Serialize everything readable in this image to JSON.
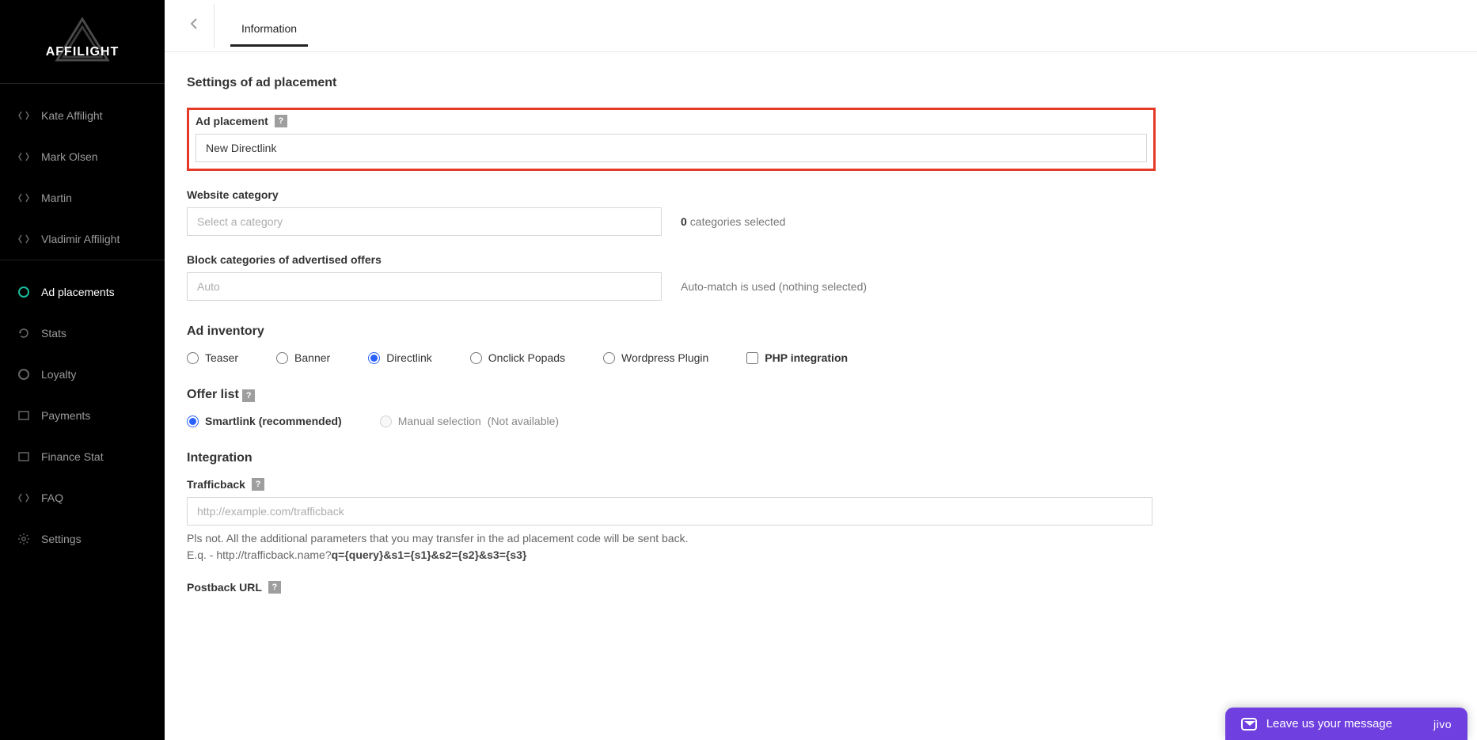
{
  "brand": {
    "name": "AFFILIGHT"
  },
  "sidebar": {
    "users": [
      {
        "label": "Kate Affilight"
      },
      {
        "label": "Mark Olsen"
      },
      {
        "label": "Martin"
      },
      {
        "label": "Vladimir Affilight"
      }
    ],
    "nav": [
      {
        "label": "Ad placements",
        "active": true,
        "icon": "ring"
      },
      {
        "label": "Stats",
        "icon": "refresh"
      },
      {
        "label": "Loyalty",
        "icon": "ring"
      },
      {
        "label": "Payments",
        "icon": "square"
      },
      {
        "label": "Finance Stat",
        "icon": "square"
      },
      {
        "label": "FAQ",
        "icon": "code"
      },
      {
        "label": "Settings",
        "icon": "gear"
      }
    ]
  },
  "tabs": {
    "information": "Information"
  },
  "page": {
    "settings_title": "Settings of ad placement",
    "ad_placement_label": "Ad placement",
    "ad_placement_value": "New Directlink",
    "website_category_label": "Website category",
    "website_category_placeholder": "Select a category",
    "categories_selected_count": "0",
    "categories_selected_text": "categories selected",
    "block_categories_label": "Block categories of advertised offers",
    "block_categories_placeholder": "Auto",
    "block_categories_hint": "Auto-match is used (nothing selected)",
    "ad_inventory_title": "Ad inventory",
    "inventory": {
      "teaser": "Teaser",
      "banner": "Banner",
      "directlink": "Directlink",
      "onclick": "Onclick Popads",
      "wordpress": "Wordpress Plugin",
      "php": "PHP integration"
    },
    "offer_list_title": "Offer list",
    "offer": {
      "smartlink": "Smartlink (recommended)",
      "manual": "Manual selection",
      "not_available": "(Not available)"
    },
    "integration_title": "Integration",
    "trafficback_label": "Trafficback",
    "trafficback_placeholder": "http://example.com/trafficback",
    "trafficback_note_pre": "Pls not. All the additional parameters that you may transfer in the ad placement code will be sent back.",
    "trafficback_note_eq_prefix": "E.q. - http://trafficback.name?",
    "trafficback_note_eq_bold": "q={query}&s1={s1}&s2={s2}&s3={s3}",
    "postback_label": "Postback URL"
  },
  "chat": {
    "message": "Leave us your message",
    "brand": "JIVO"
  }
}
